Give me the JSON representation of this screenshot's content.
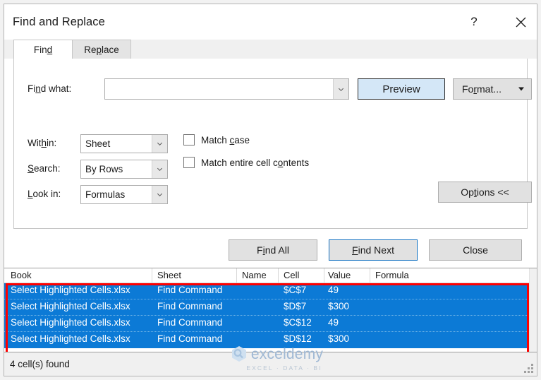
{
  "window": {
    "title": "Find and Replace",
    "help_icon": "question-mark-icon",
    "close_icon": "close-icon"
  },
  "tabs": [
    {
      "label_pre": "Fin",
      "label_accel": "d",
      "label_post": "",
      "active": true,
      "name": "find"
    },
    {
      "label_pre": "Re",
      "label_accel": "p",
      "label_post": "lace",
      "active": false,
      "name": "replace"
    }
  ],
  "find_panel": {
    "find_what": {
      "label_pre": "Fi",
      "label_accel": "n",
      "label_post": "d what:",
      "value": "",
      "placeholder": ""
    },
    "preview_button": "Preview",
    "format_button": {
      "label_pre": "Fo",
      "label_accel": "r",
      "label_post": "mat..."
    },
    "within": {
      "label_pre": "Wit",
      "label_accel": "h",
      "label_post": "in:",
      "value": "Sheet"
    },
    "search": {
      "label_pre": "",
      "label_accel": "S",
      "label_post": "earch:",
      "value": "By Rows"
    },
    "look_in": {
      "label_pre": "",
      "label_accel": "L",
      "label_post": "ook in:",
      "value": "Formulas"
    },
    "match_case": {
      "label_pre": "Match ",
      "label_accel": "c",
      "label_post": "ase",
      "checked": false
    },
    "match_entire_cell": {
      "label_pre": "Match entire cell c",
      "label_accel": "o",
      "label_post": "ntents",
      "checked": false
    },
    "options_button": {
      "label_pre": "Op",
      "label_accel": "t",
      "label_post": "ions <<"
    }
  },
  "actions": {
    "find_all": {
      "label_pre": "F",
      "label_accel": "i",
      "label_post": "nd All"
    },
    "find_next": {
      "label_pre": "",
      "label_accel": "F",
      "label_post": "ind Next"
    },
    "close": {
      "label_pre": "Close",
      "label_accel": "",
      "label_post": ""
    }
  },
  "results": {
    "columns": [
      "Book",
      "Sheet",
      "Name",
      "Cell",
      "Value",
      "Formula"
    ],
    "rows": [
      {
        "book": "Select Highlighted Cells.xlsx",
        "sheet": "Find Command",
        "name": "",
        "cell": "$C$7",
        "value": "49",
        "formula": ""
      },
      {
        "book": "Select Highlighted Cells.xlsx",
        "sheet": "Find Command",
        "name": "",
        "cell": "$D$7",
        "value": "$300",
        "formula": ""
      },
      {
        "book": "Select Highlighted Cells.xlsx",
        "sheet": "Find Command",
        "name": "",
        "cell": "$C$12",
        "value": "49",
        "formula": ""
      },
      {
        "book": "Select Highlighted Cells.xlsx",
        "sheet": "Find Command",
        "name": "",
        "cell": "$D$12",
        "value": "$300",
        "formula": ""
      }
    ],
    "selection_color": "#0c7ad6",
    "annotation_color": "#ff0000"
  },
  "statusbar": {
    "text": "4 cell(s) found"
  },
  "watermark": {
    "name": "exceldemy",
    "tagline": "EXCEL · DATA · BI"
  }
}
